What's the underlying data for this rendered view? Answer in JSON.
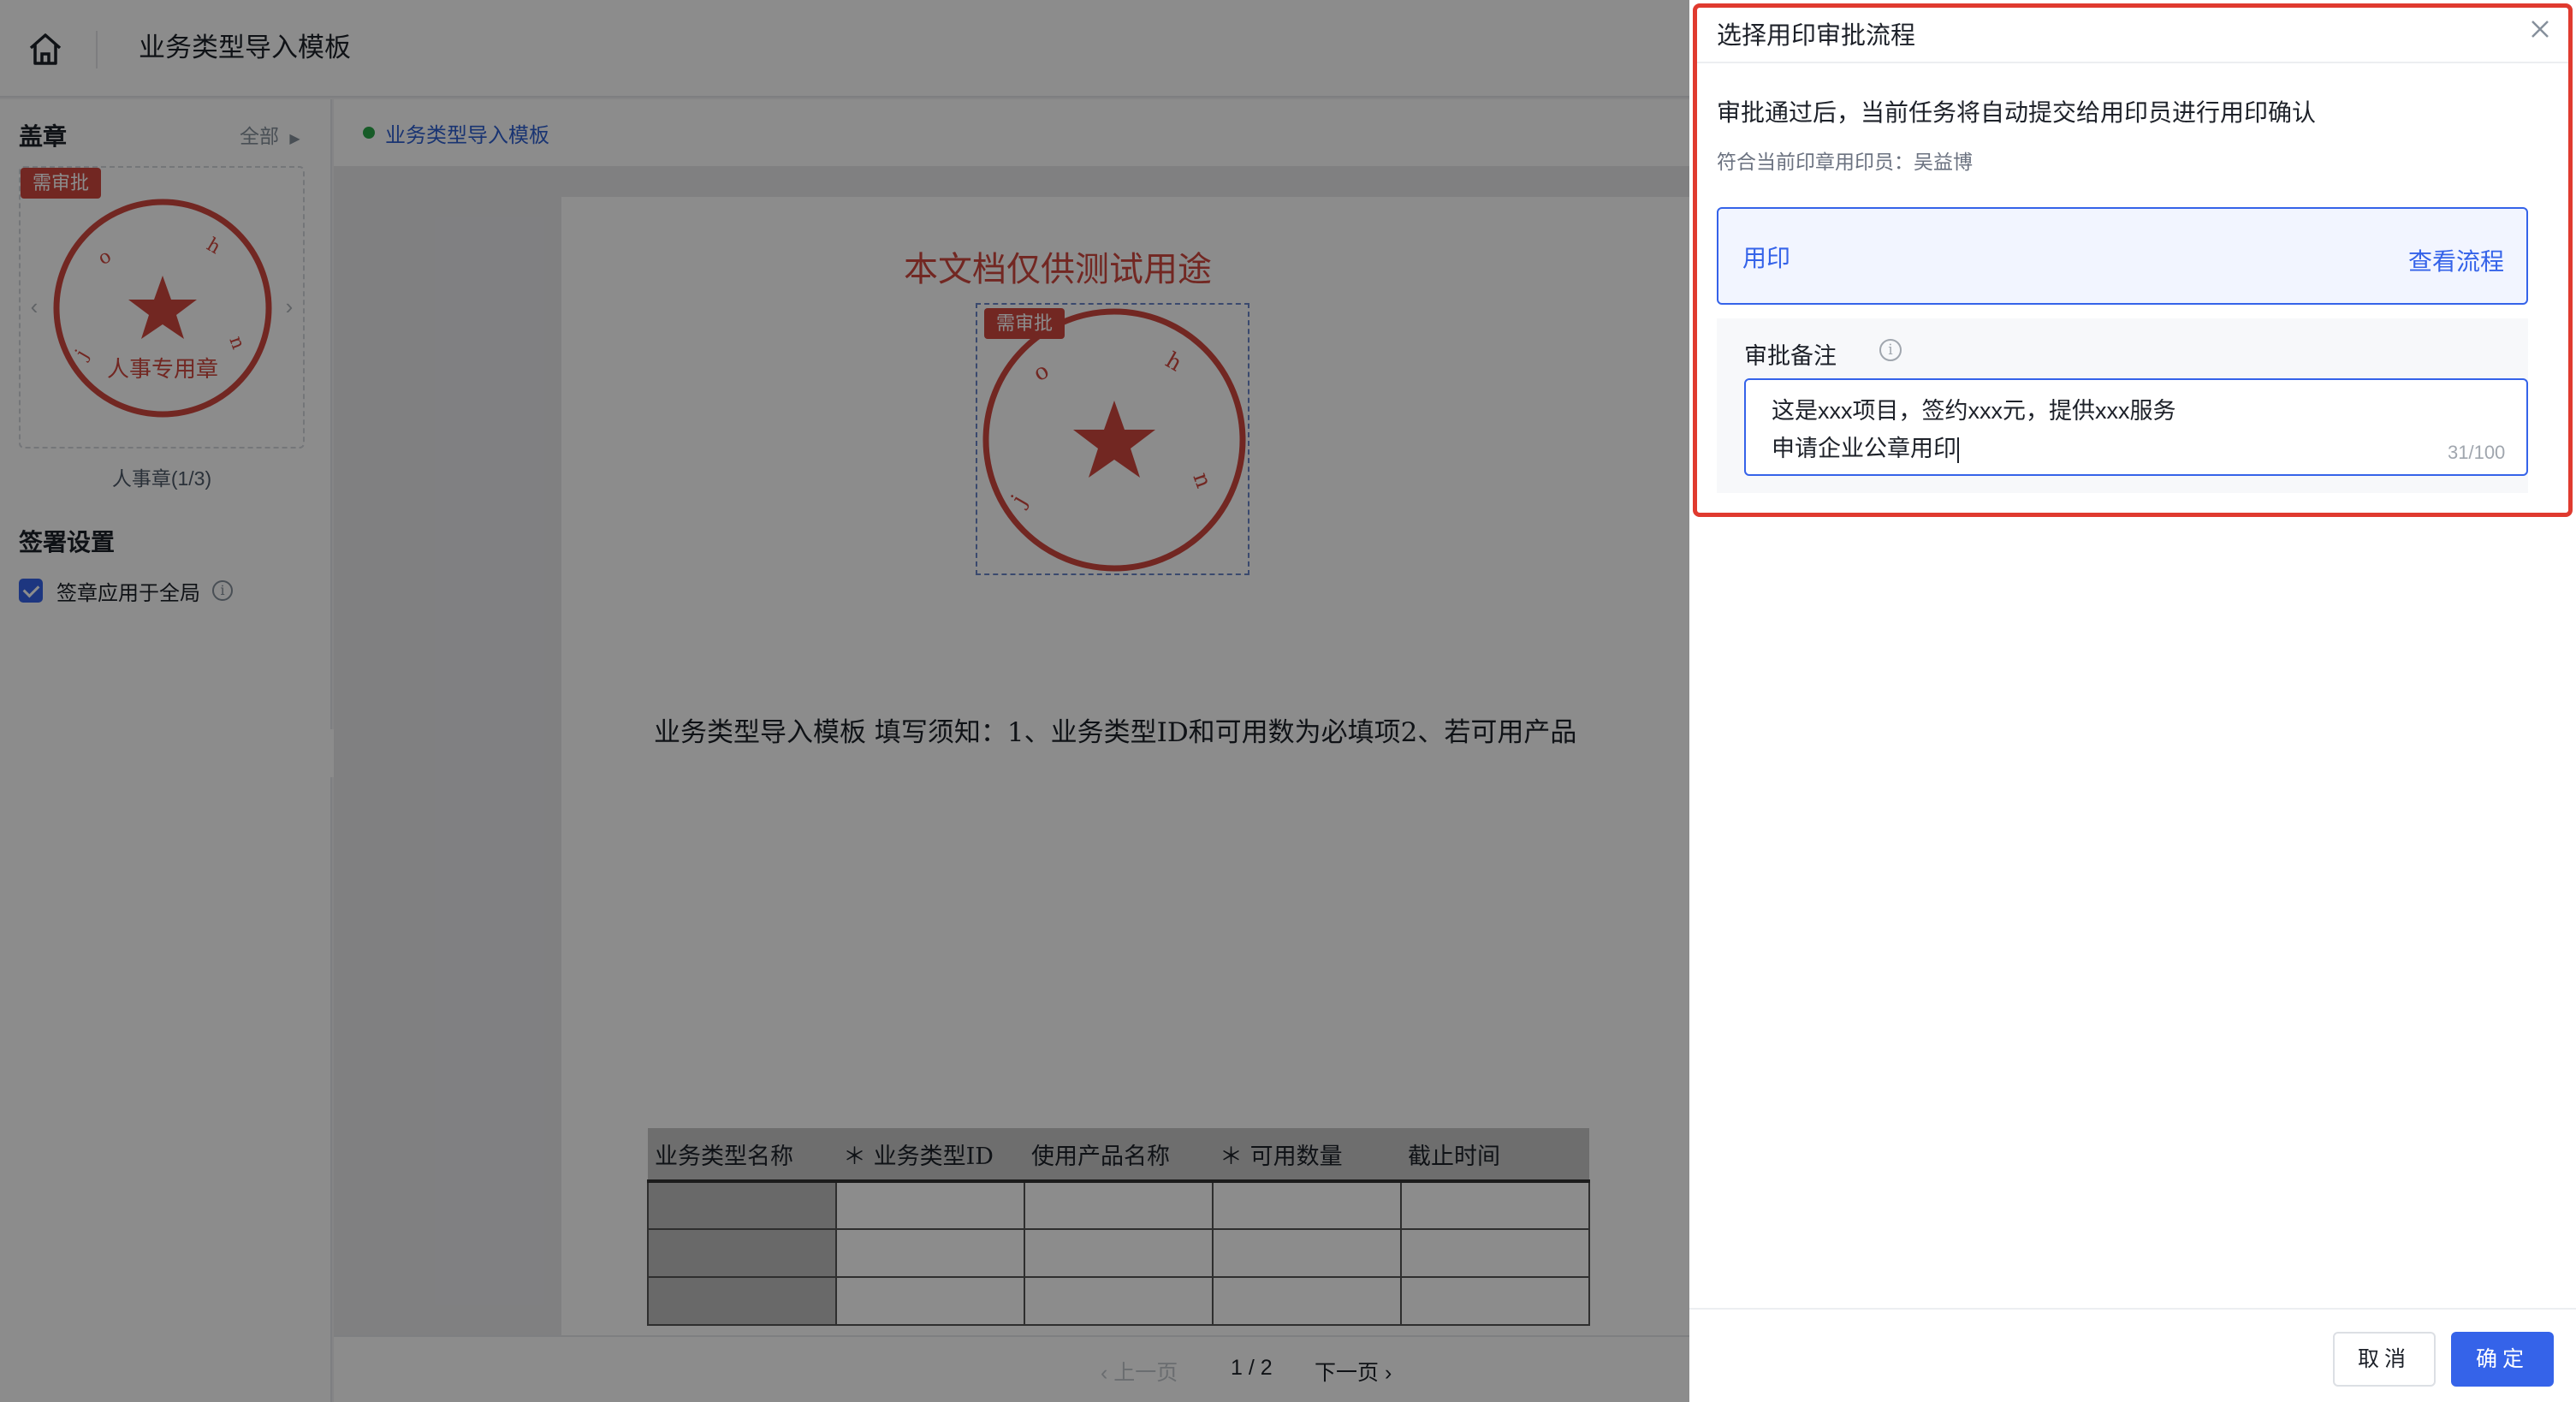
{
  "header": {
    "title": "业务类型导入模板"
  },
  "sidebar": {
    "seal_heading": "盖章",
    "all_link": "全部",
    "seal_tag": "需审批",
    "seal_text": "人事专用章",
    "seal_name": "人事章(1/3)",
    "settings_heading": "签署设置",
    "apply_global_label": "签章应用于全局"
  },
  "breadcrumb": {
    "label": "业务类型导入模板"
  },
  "document": {
    "watermark": "本文档仅供测试用途",
    "stamp_tag": "需审批",
    "body_line": "业务类型导入模板 填写须知：1、业务类型ID和可用数为必填项2、若可用产品",
    "table_headers": [
      "业务类型名称",
      "＊ 业务类型ID",
      "使用产品名称",
      "＊ 可用数量",
      "截止时间"
    ]
  },
  "pager": {
    "prev": "上一页",
    "current": "1 / 2",
    "next": "下一页"
  },
  "drawer": {
    "title": "选择用印审批流程",
    "description": "审批通过后，当前任务将自动提交给用印员进行用印确认",
    "sub_info": "符合当前印章用印员：吴益博",
    "flow_name": "用印",
    "flow_link": "查看流程",
    "remark_label": "审批备注",
    "remark_line1": "这是xxx项目，签约xxx元，提供xxx服务",
    "remark_line2": "申请企业公章用印",
    "remark_count": "31/100",
    "cancel_label": "取消",
    "ok_label": "确定"
  },
  "colors": {
    "accent": "#3563e9",
    "seal_red": "#d0473f",
    "highlight_red": "#e03a2f"
  },
  "icons": [
    "home-icon",
    "caret-right-icon",
    "chevron-left-icon",
    "chevron-right-icon",
    "star-icon",
    "info-icon",
    "close-icon"
  ]
}
